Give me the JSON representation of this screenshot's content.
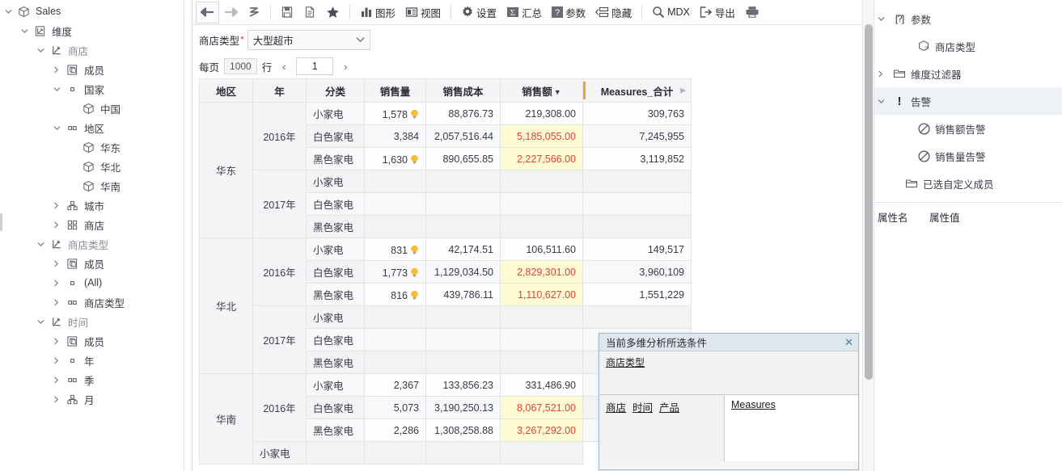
{
  "sidebar": {
    "items": [
      {
        "label": "Sales",
        "icon": "cube-icon",
        "twisty": "v",
        "indent": 0,
        "kind": "cube"
      },
      {
        "label": "维度",
        "icon": "dimension-folder-icon",
        "twisty": "v",
        "indent": 1,
        "kind": "dimfolder"
      },
      {
        "label": "商店",
        "icon": "dimension-icon",
        "twisty": "v",
        "indent": 2,
        "kind": "dim"
      },
      {
        "label": "成员",
        "icon": "member-icon",
        "twisty": ">",
        "indent": 3,
        "kind": "member"
      },
      {
        "label": "国家",
        "icon": "level1-icon",
        "twisty": "v",
        "indent": 3,
        "kind": "lv1"
      },
      {
        "label": "中国",
        "icon": "cube-icon",
        "twisty": "",
        "indent": 4,
        "kind": "cube"
      },
      {
        "label": "地区",
        "icon": "level2-icon",
        "twisty": "v",
        "indent": 3,
        "kind": "lv2"
      },
      {
        "label": "华东",
        "icon": "cube-icon",
        "twisty": "",
        "indent": 4,
        "kind": "cube"
      },
      {
        "label": "华北",
        "icon": "cube-icon",
        "twisty": "",
        "indent": 4,
        "kind": "cube"
      },
      {
        "label": "华南",
        "icon": "cube-icon",
        "twisty": "",
        "indent": 4,
        "kind": "cube"
      },
      {
        "label": "城市",
        "icon": "level3-icon",
        "twisty": ">",
        "indent": 3,
        "kind": "lv3"
      },
      {
        "label": "商店",
        "icon": "level4-icon",
        "twisty": ">",
        "indent": 3,
        "kind": "lv4"
      },
      {
        "label": "商店类型",
        "icon": "dimension-icon",
        "twisty": "v",
        "indent": 2,
        "kind": "dim"
      },
      {
        "label": "成员",
        "icon": "member-icon",
        "twisty": ">",
        "indent": 3,
        "kind": "member"
      },
      {
        "label": "(All)",
        "icon": "level1-icon",
        "twisty": ">",
        "indent": 3,
        "kind": "lv1"
      },
      {
        "label": "商店类型",
        "icon": "level2-icon",
        "twisty": ">",
        "indent": 3,
        "kind": "lv2"
      },
      {
        "label": "时间",
        "icon": "dimension-icon",
        "twisty": "v",
        "indent": 2,
        "kind": "dim"
      },
      {
        "label": "成员",
        "icon": "member-icon",
        "twisty": ">",
        "indent": 3,
        "kind": "member"
      },
      {
        "label": "年",
        "icon": "level1-icon",
        "twisty": ">",
        "indent": 3,
        "kind": "lv1"
      },
      {
        "label": "季",
        "icon": "level2-icon",
        "twisty": ">",
        "indent": 3,
        "kind": "lv2"
      },
      {
        "label": "月",
        "icon": "level3-icon",
        "twisty": ">",
        "indent": 3,
        "kind": "lv3"
      }
    ]
  },
  "toolbar": {
    "items": [
      {
        "name": "back-button",
        "icon": "arrow-left-icon",
        "label": "",
        "active": true
      },
      {
        "name": "forward-button",
        "icon": "arrow-right-icon",
        "label": ""
      },
      {
        "name": "refresh-button",
        "icon": "refresh-icon",
        "label": ""
      },
      {
        "name": "separator",
        "icon": "separator",
        "label": ""
      },
      {
        "name": "save-button",
        "icon": "save-icon",
        "label": ""
      },
      {
        "name": "copy-button",
        "icon": "document-icon",
        "label": ""
      },
      {
        "name": "favorite-button",
        "icon": "star-icon",
        "label": ""
      },
      {
        "name": "separator",
        "icon": "separator",
        "label": ""
      },
      {
        "name": "chart-button",
        "icon": "bar-chart-icon",
        "label": "图形"
      },
      {
        "name": "view-button",
        "icon": "view-icon",
        "label": "视图"
      },
      {
        "name": "separator",
        "icon": "separator",
        "label": ""
      },
      {
        "name": "settings-button",
        "icon": "gear-icon",
        "label": "设置"
      },
      {
        "name": "summary-button",
        "icon": "sigma-icon",
        "label": "汇总"
      },
      {
        "name": "params-button",
        "icon": "question-icon",
        "label": "参数"
      },
      {
        "name": "hide-button",
        "icon": "hide-icon",
        "label": "隐藏"
      },
      {
        "name": "separator",
        "icon": "separator",
        "label": ""
      },
      {
        "name": "mdx-button",
        "icon": "search-icon",
        "label": "MDX"
      },
      {
        "name": "export-button",
        "icon": "export-icon",
        "label": "导出"
      },
      {
        "name": "print-button",
        "icon": "printer-icon",
        "label": ""
      }
    ]
  },
  "filter": {
    "label": "商店类型",
    "required_mark": "*",
    "value": "大型超市"
  },
  "pager": {
    "prefix": "每页",
    "rows_value": "1000",
    "suffix": "行",
    "prev": "‹",
    "page": "1",
    "next": "›"
  },
  "table": {
    "columns": [
      "地区",
      "年",
      "分类",
      "销售量",
      "销售成本",
      "销售额",
      "Measures_合计"
    ],
    "sorted_column": "销售额",
    "sort_direction": "desc",
    "rows": [
      {
        "region": "华东",
        "region_span": 6,
        "year": "2016年",
        "year_span": 3,
        "cat": "小家电",
        "qty": "1,578",
        "qty_bulb": true,
        "cost": "88,876.73",
        "amount": "219,308.00",
        "amount_alert": false,
        "total": "309,763"
      },
      {
        "region": "",
        "region_span": 0,
        "year": "",
        "year_span": 0,
        "cat": "白色家电",
        "qty": "3,384",
        "qty_bulb": false,
        "cost": "2,057,516.44",
        "amount": "5,185,055.00",
        "amount_alert": true,
        "total": "7,245,955"
      },
      {
        "region": "",
        "region_span": 0,
        "year": "",
        "year_span": 0,
        "cat": "黑色家电",
        "qty": "1,630",
        "qty_bulb": true,
        "cost": "890,655.85",
        "amount": "2,227,566.00",
        "amount_alert": true,
        "total": "3,119,852"
      },
      {
        "region": "",
        "region_span": 0,
        "year": "2017年",
        "year_span": 3,
        "cat": "小家电",
        "qty": "",
        "qty_bulb": false,
        "cost": "",
        "amount": "",
        "amount_alert": false,
        "total": ""
      },
      {
        "region": "",
        "region_span": 0,
        "year": "",
        "year_span": 0,
        "cat": "白色家电",
        "qty": "",
        "qty_bulb": false,
        "cost": "",
        "amount": "",
        "amount_alert": false,
        "total": ""
      },
      {
        "region": "",
        "region_span": 0,
        "year": "",
        "year_span": 0,
        "cat": "黑色家电",
        "qty": "",
        "qty_bulb": false,
        "cost": "",
        "amount": "",
        "amount_alert": false,
        "total": ""
      },
      {
        "region": "华北",
        "region_span": 6,
        "year": "2016年",
        "year_span": 3,
        "cat": "小家电",
        "qty": "831",
        "qty_bulb": true,
        "cost": "42,174.51",
        "amount": "106,511.60",
        "amount_alert": false,
        "total": "149,517"
      },
      {
        "region": "",
        "region_span": 0,
        "year": "",
        "year_span": 0,
        "cat": "白色家电",
        "qty": "1,773",
        "qty_bulb": true,
        "cost": "1,129,034.50",
        "amount": "2,829,301.00",
        "amount_alert": true,
        "total": "3,960,109"
      },
      {
        "region": "",
        "region_span": 0,
        "year": "",
        "year_span": 0,
        "cat": "黑色家电",
        "qty": "816",
        "qty_bulb": true,
        "cost": "439,786.11",
        "amount": "1,110,627.00",
        "amount_alert": true,
        "total": "1,551,229"
      },
      {
        "region": "",
        "region_span": 0,
        "year": "2017年",
        "year_span": 3,
        "cat": "小家电",
        "qty": "",
        "qty_bulb": false,
        "cost": "",
        "amount": "",
        "amount_alert": false,
        "total": ""
      },
      {
        "region": "",
        "region_span": 0,
        "year": "",
        "year_span": 0,
        "cat": "白色家电",
        "qty": "",
        "qty_bulb": false,
        "cost": "",
        "amount": "",
        "amount_alert": false,
        "total": ""
      },
      {
        "region": "",
        "region_span": 0,
        "year": "",
        "year_span": 0,
        "cat": "黑色家电",
        "qty": "",
        "qty_bulb": false,
        "cost": "",
        "amount": "",
        "amount_alert": false,
        "total": ""
      },
      {
        "region": "华南",
        "region_span": 6,
        "year": "2016年",
        "year_span": 3,
        "cat": "小家电",
        "qty": "2,367",
        "qty_bulb": false,
        "cost": "133,856.23",
        "amount": "331,486.90",
        "amount_alert": false,
        "total": ""
      },
      {
        "region": "",
        "region_span": 0,
        "year": "",
        "year_span": 0,
        "cat": "白色家电",
        "qty": "5,073",
        "qty_bulb": false,
        "cost": "3,190,250.13",
        "amount": "8,067,521.00",
        "amount_alert": true,
        "total": ""
      },
      {
        "region": "",
        "region_span": 0,
        "year": "",
        "year_span": 0,
        "cat": "黑色家电",
        "qty": "2,286",
        "qty_bulb": false,
        "cost": "1,308,258.88",
        "amount": "3,267,292.00",
        "amount_alert": true,
        "total": ""
      },
      {
        "region": "",
        "region_span": 0,
        "year": "",
        "year_span": 0,
        "cat": "小家电",
        "qty": "",
        "qty_bulb": false,
        "cost": "",
        "amount": "",
        "amount_alert": false,
        "total": ""
      }
    ]
  },
  "popup": {
    "title": "当前多维分析所选条件",
    "close": "✕",
    "filter_links": [
      "商店类型"
    ],
    "row_links": [
      "商店",
      "时间",
      "产品"
    ],
    "col_links": [
      "Measures"
    ]
  },
  "rightpanel": {
    "items": [
      {
        "label": "参数",
        "icon": "param-bracket-icon",
        "twisty": "v",
        "indent": 0,
        "selected": false
      },
      {
        "label": "商店类型",
        "icon": "param-cube-icon",
        "twisty": "",
        "indent": 1,
        "selected": false
      },
      {
        "label": "维度过滤器",
        "icon": "folder-icon",
        "twisty": ">",
        "indent": 0,
        "selected": false
      },
      {
        "label": "告警",
        "icon": "exclamation-icon",
        "twisty": "v",
        "indent": 0,
        "selected": true
      },
      {
        "label": "销售额告警",
        "icon": "forbidden-icon",
        "twisty": "",
        "indent": 1,
        "selected": false
      },
      {
        "label": "销售量告警",
        "icon": "forbidden-icon",
        "twisty": "",
        "indent": 1,
        "selected": false
      },
      {
        "label": "已选自定义成员",
        "icon": "folder-icon",
        "twisty": "",
        "indent": 0.5,
        "selected": false
      }
    ],
    "attr_header": {
      "name": "属性名",
      "value": "属性值"
    }
  },
  "colors": {
    "alert_bg": "#fdfbd4",
    "alert_text": "#e8403a",
    "header_bg": "#f4f5f7",
    "selected_row": "#eef1f6",
    "accent_orange": "#e8a33d",
    "required_star": "#e23b2e"
  }
}
